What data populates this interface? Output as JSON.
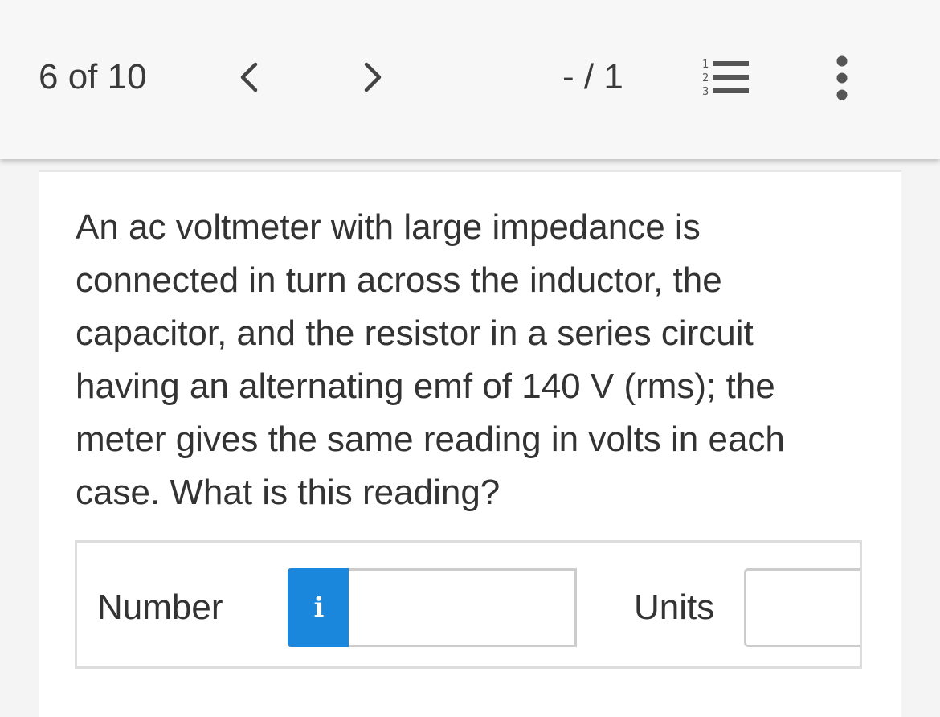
{
  "header": {
    "question_counter": "6 of 10",
    "prev_icon": "chevron-left-icon",
    "next_icon": "chevron-right-icon",
    "score": "- / 1",
    "list_icon": "numbered-list-icon",
    "more_icon": "vertical-ellipsis-icon"
  },
  "question": {
    "text": "An ac voltmeter with large impedance is connected in turn across the inductor, the capacitor, and the resistor in a series circuit having an alternating emf of 140 V (rms); the meter gives the same reading in volts in each case. What is this reading?"
  },
  "answer": {
    "number_label": "Number",
    "info_button_label": "i",
    "number_value": "",
    "units_label": "Units",
    "units_value": ""
  },
  "colors": {
    "accent": "#1a86dc",
    "header_bg": "#f7f7f7",
    "text": "#333333",
    "input_border": "#cccccc"
  }
}
